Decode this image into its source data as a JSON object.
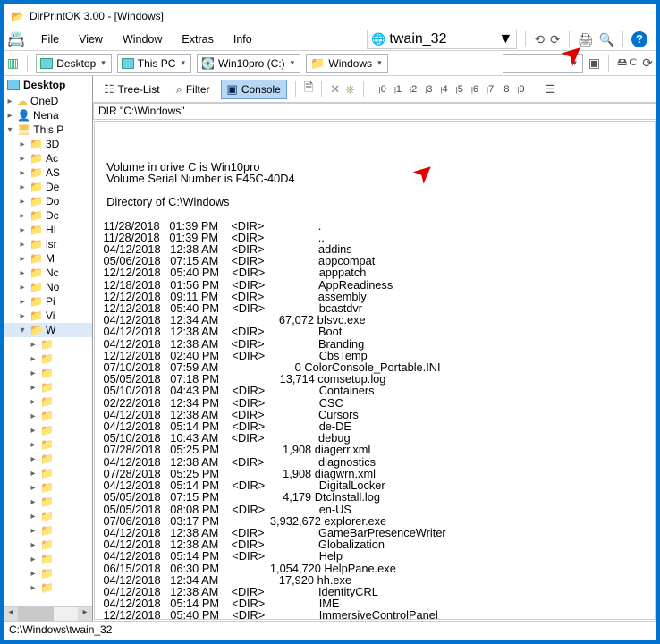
{
  "window": {
    "title": "DirPrintOK 3.00 - [Windows]"
  },
  "menu": {
    "items": [
      "File",
      "View",
      "Window",
      "Extras",
      "Info"
    ],
    "twain": "twain_32"
  },
  "location": {
    "desktop": "Desktop",
    "thispc": "This PC",
    "drive": "Win10pro (C:)",
    "folder": "Windows"
  },
  "toolbar": {
    "treelist": "Tree-List",
    "filter": "Filter",
    "console": "Console",
    "markers": [
      "0",
      "1",
      "2",
      "3",
      "4",
      "5",
      "6",
      "7",
      "8",
      "9"
    ]
  },
  "pathline": "DIR \"C:\\Windows\"",
  "tree": {
    "root": "Desktop",
    "items": [
      {
        "label": "OneD",
        "ico": "cloud"
      },
      {
        "label": "Nena",
        "ico": "user"
      },
      {
        "label": "This P",
        "ico": "pc",
        "sel": true,
        "expanded": true,
        "children": [
          {
            "label": "3D"
          },
          {
            "label": "Ac"
          },
          {
            "label": "AS"
          },
          {
            "label": "De"
          },
          {
            "label": "Do"
          },
          {
            "label": "Dc"
          },
          {
            "label": "HI"
          },
          {
            "label": "isr"
          },
          {
            "label": "M"
          },
          {
            "label": "Nc"
          },
          {
            "label": "No"
          },
          {
            "label": "Pi"
          },
          {
            "label": "Vi"
          },
          {
            "label": "W",
            "sel": true,
            "expanded": true
          }
        ]
      }
    ]
  },
  "console": {
    "header": [
      "  Volume in drive C is Win10pro",
      "  Volume Serial Number is F45C-40D4",
      "",
      "  Directory of C:\\Windows",
      ""
    ],
    "rows": [
      [
        "11/28/2018",
        "01:39 PM",
        "<DIR>",
        "",
        "."
      ],
      [
        "11/28/2018",
        "01:39 PM",
        "<DIR>",
        "",
        ".."
      ],
      [
        "04/12/2018",
        "12:38 AM",
        "<DIR>",
        "",
        "addins"
      ],
      [
        "05/06/2018",
        "07:15 AM",
        "<DIR>",
        "",
        "appcompat"
      ],
      [
        "12/12/2018",
        "05:40 PM",
        "<DIR>",
        "",
        "apppatch"
      ],
      [
        "12/18/2018",
        "01:56 PM",
        "<DIR>",
        "",
        "AppReadiness"
      ],
      [
        "12/12/2018",
        "09:11 PM",
        "<DIR>",
        "",
        "assembly"
      ],
      [
        "12/12/2018",
        "05:40 PM",
        "<DIR>",
        "",
        "bcastdvr"
      ],
      [
        "04/12/2018",
        "12:34 AM",
        "",
        "67,072",
        "bfsvc.exe"
      ],
      [
        "04/12/2018",
        "12:38 AM",
        "<DIR>",
        "",
        "Boot"
      ],
      [
        "04/12/2018",
        "12:38 AM",
        "<DIR>",
        "",
        "Branding"
      ],
      [
        "12/12/2018",
        "02:40 PM",
        "<DIR>",
        "",
        "CbsTemp"
      ],
      [
        "07/10/2018",
        "07:59 AM",
        "",
        "0",
        "ColorConsole_Portable.INI"
      ],
      [
        "05/05/2018",
        "07:18 PM",
        "",
        "13,714",
        "comsetup.log"
      ],
      [
        "05/10/2018",
        "04:43 PM",
        "<DIR>",
        "",
        "Containers"
      ],
      [
        "02/22/2018",
        "12:34 PM",
        "<DIR>",
        "",
        "CSC"
      ],
      [
        "04/12/2018",
        "12:38 AM",
        "<DIR>",
        "",
        "Cursors"
      ],
      [
        "04/12/2018",
        "05:14 PM",
        "<DIR>",
        "",
        "de-DE"
      ],
      [
        "05/10/2018",
        "10:43 AM",
        "<DIR>",
        "",
        "debug"
      ],
      [
        "07/28/2018",
        "05:25 PM",
        "",
        "1,908",
        "diagerr.xml"
      ],
      [
        "04/12/2018",
        "12:38 AM",
        "<DIR>",
        "",
        "diagnostics"
      ],
      [
        "07/28/2018",
        "05:25 PM",
        "",
        "1,908",
        "diagwrn.xml"
      ],
      [
        "04/12/2018",
        "05:14 PM",
        "<DIR>",
        "",
        "DigitalLocker"
      ],
      [
        "05/05/2018",
        "07:15 PM",
        "",
        "4,179",
        "DtcInstall.log"
      ],
      [
        "05/05/2018",
        "08:08 PM",
        "<DIR>",
        "",
        "en-US"
      ],
      [
        "07/06/2018",
        "03:17 PM",
        "",
        "3,932,672",
        "explorer.exe"
      ],
      [
        "04/12/2018",
        "12:38 AM",
        "<DIR>",
        "",
        "GameBarPresenceWriter"
      ],
      [
        "04/12/2018",
        "12:38 AM",
        "<DIR>",
        "",
        "Globalization"
      ],
      [
        "04/12/2018",
        "05:14 PM",
        "<DIR>",
        "",
        "Help"
      ],
      [
        "06/15/2018",
        "06:30 PM",
        "",
        "1,054,720",
        "HelpPane.exe"
      ],
      [
        "04/12/2018",
        "12:34 AM",
        "",
        "17,920",
        "hh.exe"
      ],
      [
        "04/12/2018",
        "12:38 AM",
        "<DIR>",
        "",
        "IdentityCRL"
      ],
      [
        "04/12/2018",
        "05:14 PM",
        "<DIR>",
        "",
        "IME"
      ],
      [
        "12/12/2018",
        "05:40 PM",
        "<DIR>",
        "",
        "ImmersiveControlPanel"
      ]
    ]
  },
  "status": {
    "path": "C:\\Windows\\twain_32"
  }
}
